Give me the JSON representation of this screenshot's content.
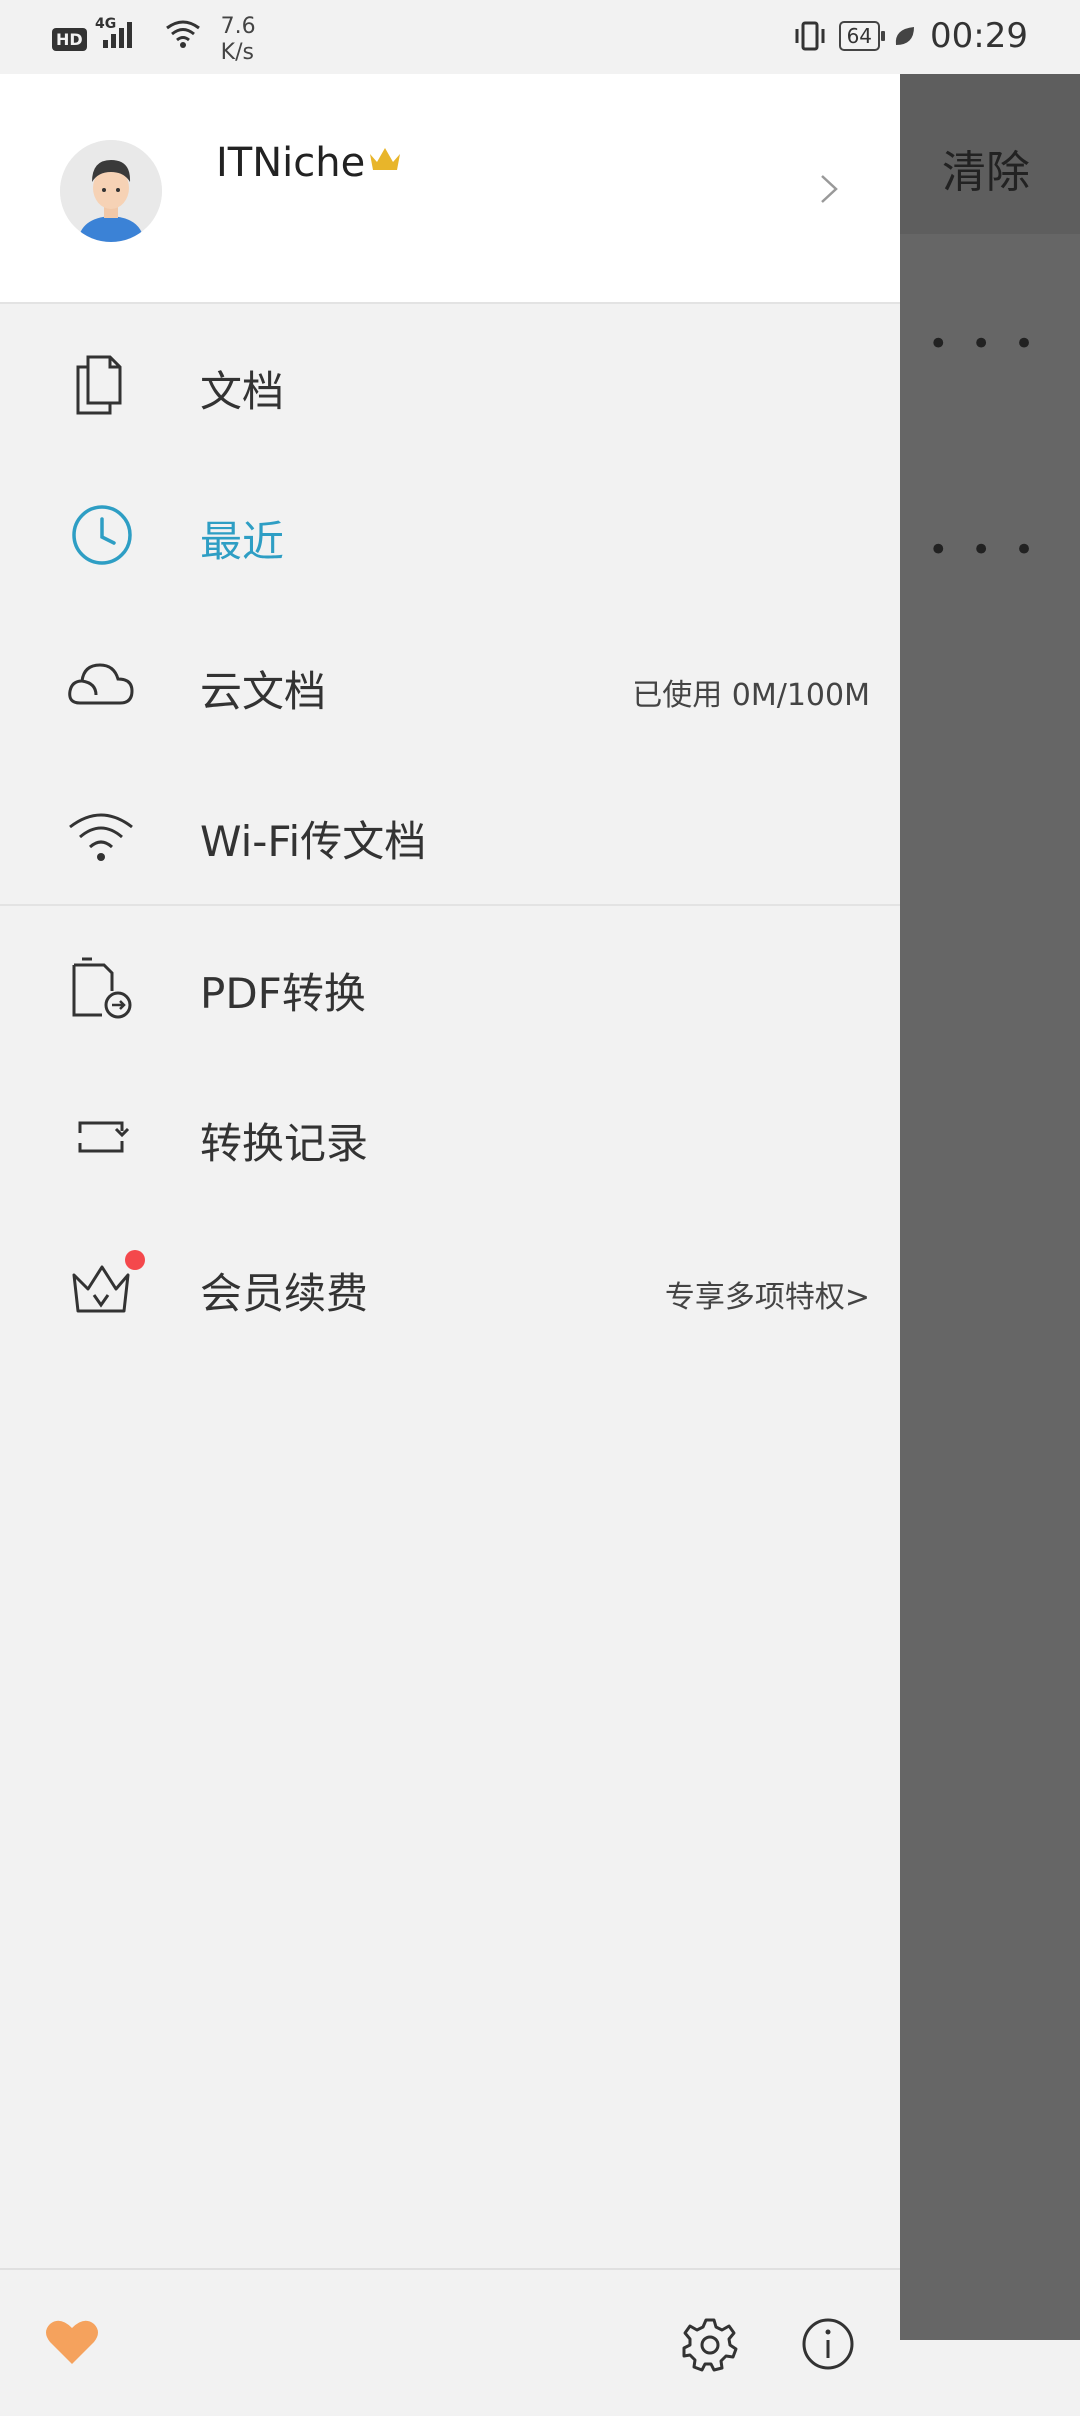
{
  "status_bar": {
    "network": "4G",
    "speed": "7.6",
    "speed_unit": "K/s",
    "battery": "64",
    "time": "00:29"
  },
  "profile": {
    "username": "ITNiche",
    "avatar_icon": "avatar-man",
    "badge_icon": "crown-icon",
    "badge_color": "#e8b52a"
  },
  "menu": {
    "items": [
      {
        "label": "文档",
        "icon": "document-icon",
        "meta": ""
      },
      {
        "label": "最近",
        "icon": "clock-icon",
        "meta": "",
        "active": true
      },
      {
        "label": "云文档",
        "icon": "cloud-icon",
        "meta": "已使用 0M/100M"
      },
      {
        "label": "Wi-Fi传文档",
        "icon": "wifi-icon",
        "meta": ""
      },
      {
        "label": "PDF转换",
        "icon": "pdf-convert-icon",
        "meta": ""
      },
      {
        "label": "转换记录",
        "icon": "convert-record-icon",
        "meta": ""
      },
      {
        "label": "会员续费",
        "icon": "membership-crown-icon",
        "meta": "专享多项特权>"
      }
    ]
  },
  "background_panel": {
    "clear_label": "清除",
    "more_1": "• • •",
    "more_2": "• • •"
  },
  "colors": {
    "accent": "#2e9ec4",
    "notification_dot": "#f4484c",
    "heart": "#f5a25d"
  }
}
